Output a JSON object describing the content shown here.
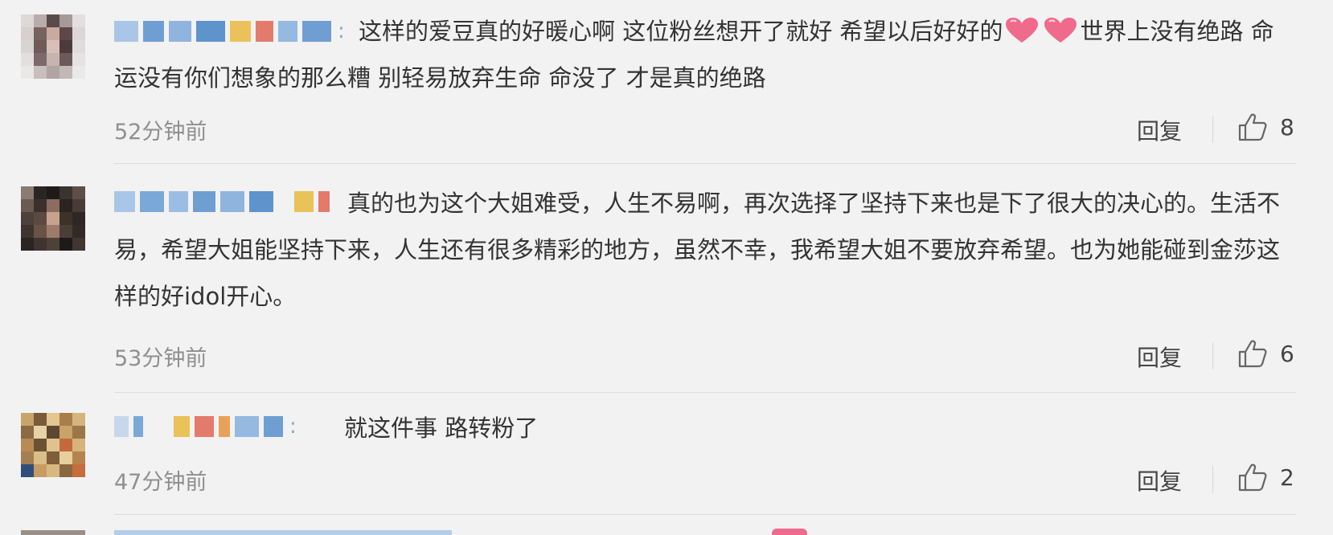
{
  "comments": [
    {
      "text_part1": "这样的爱豆真的好暖心啊 这位粉丝想开了就好 希望以后好好的",
      "text_part2": "世界上没有绝路 命运没有你们想象的那么糟 别轻易放弃生命 命没了 才是真的绝路",
      "time": "52分钟前",
      "reply_label": "回复",
      "likes": "8"
    },
    {
      "text": "真的也为这个大姐难受，人生不易啊，再次选择了坚持下来也是下了很大的决心的。生活不易，希望大姐能坚持下来，人生还有很多精彩的地方，虽然不幸，我希望大姐不要放弃希望。也为她能碰到金莎这样的好idol开心。",
      "time": "53分钟前",
      "reply_label": "回复",
      "likes": "6"
    },
    {
      "text": "就这件事 路转粉了",
      "time": "47分钟前",
      "reply_label": "回复",
      "likes": "2"
    }
  ],
  "colors": {
    "background": "#f2f2f2",
    "username_blue": "#7aa9d8",
    "heart_pink": "#f06a8c"
  },
  "icons": [
    "thumbs-up-icon",
    "heart-emoji-icon"
  ]
}
